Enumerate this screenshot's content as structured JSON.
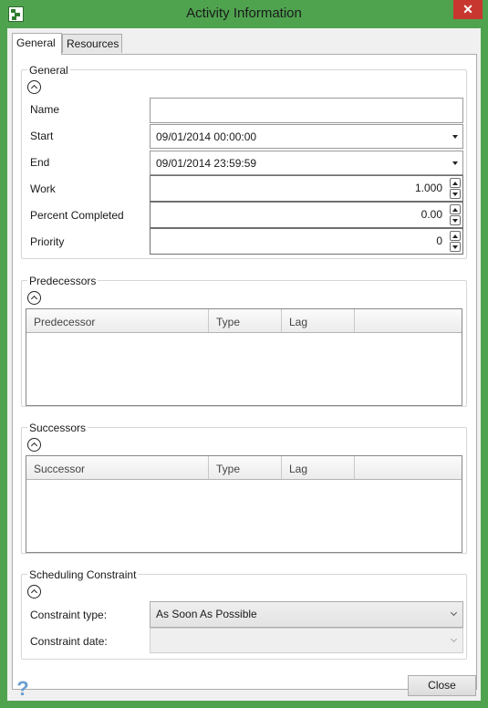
{
  "window": {
    "title": "Activity Information",
    "close_glyph": "✕"
  },
  "tabs": [
    {
      "label": "General"
    },
    {
      "label": "Resources"
    }
  ],
  "general": {
    "title": "General",
    "name": {
      "label": "Name",
      "value": ""
    },
    "start": {
      "label": "Start",
      "value": "09/01/2014 00:00:00"
    },
    "end": {
      "label": "End",
      "value": "09/01/2014 23:59:59"
    },
    "work": {
      "label": "Work",
      "value": "1.000"
    },
    "percent": {
      "label": "Percent Completed",
      "value": "0.00"
    },
    "priority": {
      "label": "Priority",
      "value": "0"
    }
  },
  "predecessors": {
    "title": "Predecessors",
    "columns": [
      "Predecessor",
      "Type",
      "Lag"
    ]
  },
  "successors": {
    "title": "Successors",
    "columns": [
      "Successor",
      "Type",
      "Lag"
    ]
  },
  "constraint": {
    "title": "Scheduling Constraint",
    "type_label": "Constraint type:",
    "type_value": "As Soon As Possible",
    "date_label": "Constraint date:",
    "date_value": ""
  },
  "footer": {
    "help_glyph": "?",
    "close_label": "Close"
  },
  "colors": {
    "window_frame": "#4fa34f",
    "close_x": "#c7372f"
  }
}
